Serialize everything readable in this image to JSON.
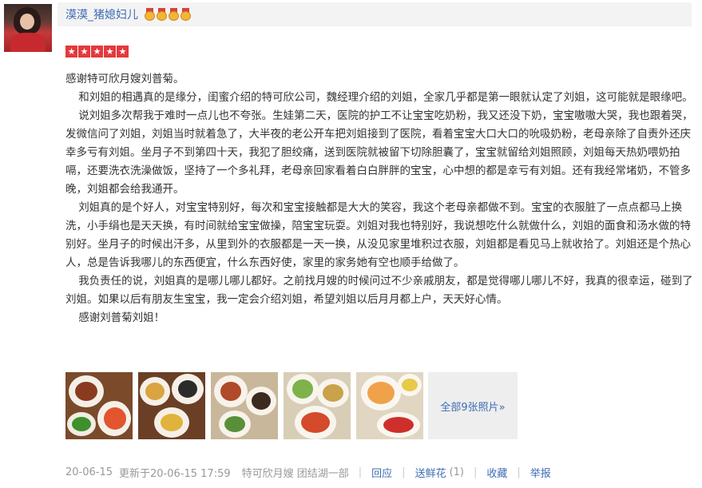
{
  "header": {
    "username": "漠漠_猪媳妇儿",
    "medal_icons": [
      "medal-icon",
      "medal-icon",
      "medal-icon",
      "medal-icon"
    ]
  },
  "rating": {
    "stars": 5,
    "star_color": "#e4393c"
  },
  "review": {
    "paragraphs": [
      "感谢特可欣月嫂刘普菊。",
      "和刘姐的相遇真的是缘分，闺蜜介绍的特可欣公司，魏经理介绍的刘姐，全家几乎都是第一眼就认定了刘姐，这可能就是眼缘吧。",
      "说刘姐多次帮我于难时一点儿也不夸张。生娃第二天，医院的护工不让宝宝吃奶粉，我又还没下奶，宝宝嗷嗷大哭，我也跟着哭，发微信问了刘姐，刘姐当时就着急了，大半夜的老公开车把刘姐接到了医院，看着宝宝大口大口的吮吸奶粉，老母亲除了自责外还庆幸多亏有刘姐。坐月子不到第四十天，我犯了胆绞痛，送到医院就被留下切除胆囊了，宝宝就留给刘姐照顾，刘姐每天热奶喂奶拍嗝，还要洗衣洗澡做饭，坚持了一个多礼拜，老母亲回家看着白白胖胖的宝宝，心中想的都是幸亏有刘姐。还有我经常堵奶，不管多晚，刘姐都会给我通开。",
      "刘姐真的是个好人，对宝宝特别好，每次和宝宝接触都是大大的笑容，我这个老母亲都做不到。宝宝的衣服脏了一点点都马上换洗，小手绢也是天天换，有时间就给宝宝做操，陪宝宝玩耍。刘姐对我也特别好，我说想吃什么就做什么，刘姐的面食和汤水做的特别好。坐月子的时候出汗多，从里到外的衣服都是一天一换，从没见家里堆积过衣服，刘姐都是看见马上就收拾了。刘姐还是个热心人，总是告诉我哪儿的东西便宜，什么东西好使，家里的家务她有空也顺手给做了。",
      "我负责任的说，刘姐真的是哪儿哪儿都好。之前找月嫂的时候问过不少亲戚朋友，都是觉得哪儿哪儿不好，我真的很幸运，碰到了刘姐。如果以后有朋友生宝宝，我一定会介绍刘姐，希望刘姐以后月月都上户，天天好心情。",
      "感谢刘普菊刘姐！"
    ]
  },
  "photos": {
    "more_label": "全部9张照片»"
  },
  "footer": {
    "date": "20-06-15",
    "updated": "更新于20-06-15 17:59",
    "shop": "特可欣月嫂 团结湖一部",
    "reply": "回应",
    "flowers": "送鲜花",
    "flowers_count": "(1)",
    "favorite": "收藏",
    "report": "举报"
  }
}
